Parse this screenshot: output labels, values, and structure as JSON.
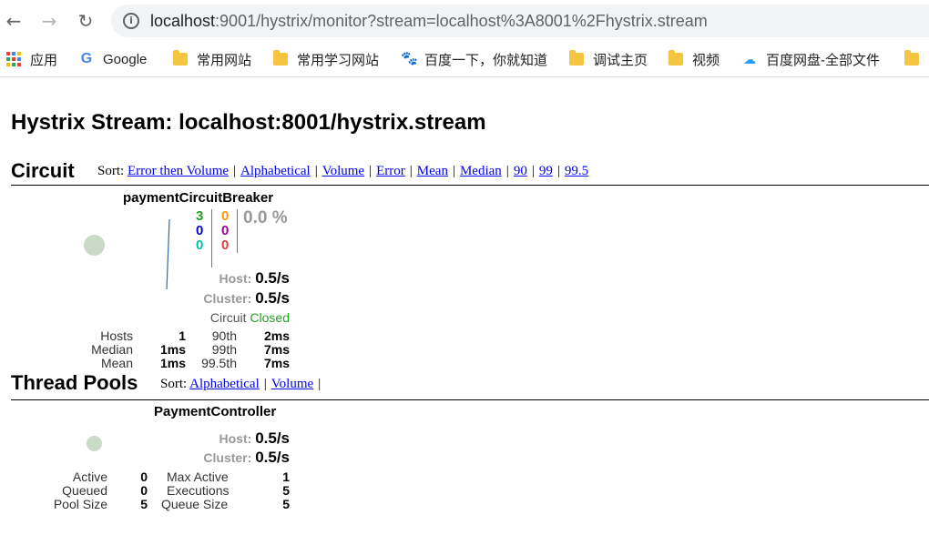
{
  "browser": {
    "back_icon": "←",
    "forward_icon": "→",
    "reload_icon": "↻",
    "info_icon": "i",
    "url_host": "localhost",
    "url_rest": ":9001/hystrix/monitor?stream=localhost%3A8001%2Fhystrix.stream"
  },
  "bookmarks": [
    {
      "label": "应用",
      "icon": "apps-grid-icon"
    },
    {
      "label": "Google",
      "icon": "google-icon"
    },
    {
      "label": "常用网站",
      "icon": "folder-icon"
    },
    {
      "label": "常用学习网站",
      "icon": "folder-icon"
    },
    {
      "label": "百度一下，你就知道",
      "icon": "baidu-paw-icon"
    },
    {
      "label": "调试主页",
      "icon": "folder-icon"
    },
    {
      "label": "视频",
      "icon": "folder-icon"
    },
    {
      "label": "百度网盘-全部文件",
      "icon": "baidu-cloud-icon"
    },
    {
      "label": "",
      "icon": "folder-icon"
    }
  ],
  "page_title": "Hystrix Stream: localhost:8001/hystrix.stream",
  "circuit": {
    "heading": "Circuit",
    "sort_label": "Sort:",
    "sort_options": [
      "Error then Volume",
      "Alphabetical",
      "Volume",
      "Error",
      "Mean",
      "Median",
      "90",
      "99",
      "99.5"
    ],
    "card": {
      "name": "paymentCircuitBreaker",
      "counts": {
        "success": "3",
        "short_circuited": "0",
        "bad_request": "0",
        "timeout": "0",
        "rejected": "0",
        "failure": "0"
      },
      "error_pct": "0.0 %",
      "host_label": "Host:",
      "host_rate": "0.5/s",
      "cluster_label": "Cluster:",
      "cluster_rate": "0.5/s",
      "circuit_label": "Circuit",
      "circuit_status": "Closed",
      "stats": {
        "hosts_label": "Hosts",
        "hosts_value": "1",
        "median_label": "Median",
        "median_value": "1ms",
        "mean_label": "Mean",
        "mean_value": "1ms",
        "p90_label": "90th",
        "p90_value": "2ms",
        "p99_label": "99th",
        "p99_value": "7ms",
        "p995_label": "99.5th",
        "p995_value": "7ms"
      }
    }
  },
  "thread_pools": {
    "heading": "Thread Pools",
    "sort_label": "Sort:",
    "sort_options": [
      "Alphabetical",
      "Volume"
    ],
    "card": {
      "name": "PaymentController",
      "host_label": "Host:",
      "host_rate": "0.5/s",
      "cluster_label": "Cluster:",
      "cluster_rate": "0.5/s",
      "stats": {
        "active_label": "Active",
        "active_value": "0",
        "queued_label": "Queued",
        "queued_value": "0",
        "pool_size_label": "Pool Size",
        "pool_size_value": "5",
        "max_active_label": "Max Active",
        "max_active_value": "1",
        "executions_label": "Executions",
        "executions_value": "5",
        "queue_size_label": "Queue Size",
        "queue_size_value": "5"
      }
    }
  },
  "colors": {
    "success": "#2a9d2a",
    "short_circuited": "#0000cc",
    "bad_request": "#00c4a8",
    "timeout": "#ff9900",
    "rejected": "#990099",
    "failure": "#e23b3b",
    "link": "#0000ee",
    "closed": "#2a9d2a",
    "bubble": "#c9dac7"
  }
}
